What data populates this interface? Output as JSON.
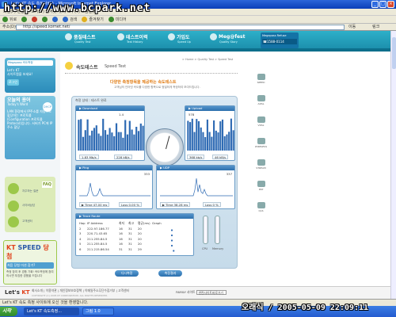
{
  "window": {
    "title": "Let's KT 속도 측정서비스 - Microsoft Internet Explorer"
  },
  "watermark": "http://www.bcpark.net",
  "menu": "파일(F)  편집(E)  보기(V)  즐겨찾기(A)  도구(T)  도움말(H)",
  "toolbar": {
    "back": "뒤로",
    "search": "검색",
    "favorites": "즐겨찾기",
    "media": "미디어"
  },
  "address": {
    "label": "주소(D)",
    "url": "http://speed.kornet.net/",
    "go": "이동",
    "links": "링크"
  },
  "topnav": {
    "items": [
      {
        "label": "품질테스트",
        "sub": "Quality Test"
      },
      {
        "label": "테스트이력",
        "sub": "Test History"
      },
      {
        "label": "가입도",
        "sub": "Speed Up"
      },
      {
        "label": "Meg@fest",
        "sub": "Quality Story"
      }
    ],
    "member": {
      "title": "Megapass Refuse",
      "phone": "☎1588-0114"
    }
  },
  "left": {
    "login": {
      "logo": "Megapass 속도측정",
      "text1": "Let's KT",
      "text2": "사이트맵을 보세요!",
      "btn": "로그인"
    },
    "tip": {
      "title": "오늘의 용어",
      "sub": "Today's Word",
      "ball": "DHCP",
      "body": "LAN 환경에서 IP주소를 자동으로 할당하는 프로토콜(Configuration 프로토콜Protocol)입니다. 서버가 PC에 IP 주소 할당"
    },
    "faq": {
      "label": "FAQ",
      "items": [
        "자주하는 질문",
        "사이버상담",
        "고객센터"
      ]
    },
    "kt": {
      "logo_a": "KT",
      "logo_b": "SPEED",
      "tag": "당첨",
      "event": "처음 당첨 미션 참가?",
      "body": "측정 참여 후 경품 기회! 속도측정에 참여하시면 푸짐한 경품을 드립니다"
    }
  },
  "content": {
    "breadcrumb": "> Home > Quality Test > Speed Test",
    "title": "속도테스트",
    "title_en": "Speed Test",
    "intro": "다양한 측정항목을 제공하는 속도테스트",
    "intro_sub": "고객님의 인터넷 속도를 다양한 항목으로 정밀하게 측정하여 보여드립니다.",
    "panel_title": "측정 상태 : 테스트 완료",
    "download": {
      "label": "▶ Download",
      "peak": "1.4",
      "reading1": "1.83 Mb/s",
      "reading2": "228 kB/s"
    },
    "upload": {
      "label": "▶ Upload",
      "peak": "578",
      "reading1": "368 kb/s",
      "reading2": "46 kB/s"
    },
    "ping": {
      "label": "▶ Ping",
      "max": "333",
      "reading1": "▶ Time  47.00 ms",
      "reading2": "Loss  0.00 %"
    },
    "udp": {
      "label": "▶ UDP",
      "max": "337",
      "reading1": "▶ Time  38.28 ms",
      "reading2": "Loss  0 %"
    },
    "trace": {
      "label": "▶ Trace Route",
      "headers": [
        "Hop",
        "IP Address",
        "최저",
        "최고",
        "평균(ms)",
        "Graph"
      ],
      "rows": [
        [
          "2",
          "222.97.186.77",
          "16",
          "31",
          "20"
        ],
        [
          "3",
          "220.71.43.65",
          "16",
          "31",
          "20"
        ],
        [
          "4",
          "211.255.84.5",
          "16",
          "31",
          "20"
        ],
        [
          "5",
          "211.255.84.5",
          "16",
          "31",
          "20"
        ],
        [
          "6",
          "211.215.86.54",
          "31",
          "31",
          "29"
        ]
      ]
    },
    "tubes": {
      "a": "CPU",
      "b": "Memory"
    },
    "buttons": {
      "retry": "다시측정",
      "save": "측정결과"
    }
  },
  "right": {
    "links": [
      "SPEED",
      "ADSL",
      "VDSL",
      "WIRELESS",
      "STREAM",
      "P2P",
      "QoS"
    ]
  },
  "footer": {
    "logo_a": "Let's ",
    "logo_b": "KT",
    "links": "회사소개 | 이용약관 | 개인정보보호정책 | 이메일주소무단수집거부 | 고객센터",
    "copy": "COPYRIGHT (C) 2005 KT CORPORATION. ALL RIGHTS RESERVED.",
    "family_label": "FAMILY 사이트",
    "family_select": "관련사이트바로가기"
  },
  "status": "Let's KT 속도 측정 사이트에 오신 것을 환영합니다.",
  "clock": "오래식 / 2005-05-09 22:09:11",
  "taskbar": {
    "start": "시작",
    "tasks": [
      "Let's KT 속도측정...",
      "그림 1.0"
    ]
  }
}
